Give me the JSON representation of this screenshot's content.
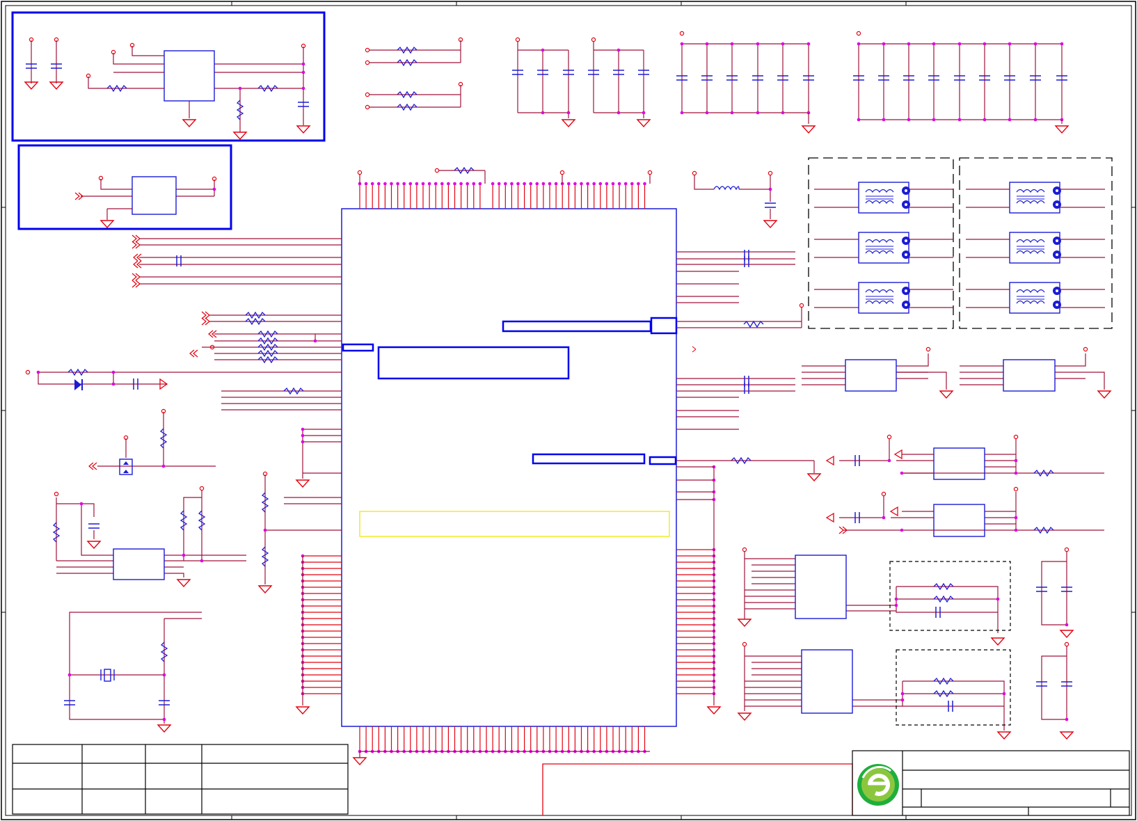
{
  "document": {
    "type": "schematic",
    "colors": {
      "wire": "#a0133a",
      "pin": "#e3000f",
      "component": "#1b1bd6",
      "junction": "#e000e0",
      "highlight_box": "#0000ee",
      "note_box": "#f2ea2a",
      "frame": "#000000"
    },
    "logo": {
      "icon": "green-e-circle-logo",
      "colors": [
        "#1fae3c",
        "#8cc63f"
      ]
    }
  }
}
